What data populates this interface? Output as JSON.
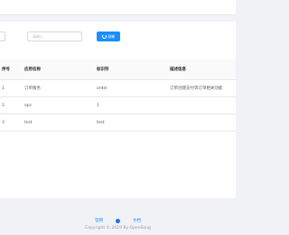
{
  "search": {
    "placeholder": "请输入",
    "button_label": "刷新",
    "button_icon": "refresh-icon"
  },
  "table": {
    "headers": [
      "序号",
      "应用名称",
      "标识符",
      "描述信息"
    ],
    "rows": [
      [
        "1",
        "订单服务",
        "order",
        "订单创建支付等订单相关功能"
      ],
      [
        "2",
        "ops",
        "1",
        ""
      ],
      [
        "3",
        "test",
        "test",
        ""
      ]
    ]
  },
  "footer": {
    "links": [
      "官网",
      "文档"
    ],
    "github_icon": "github-icon",
    "copyright": "Copyright © 2019 By OpenSoug"
  },
  "colors": {
    "accent": "#1890ff",
    "background": "#f0f2f5"
  }
}
